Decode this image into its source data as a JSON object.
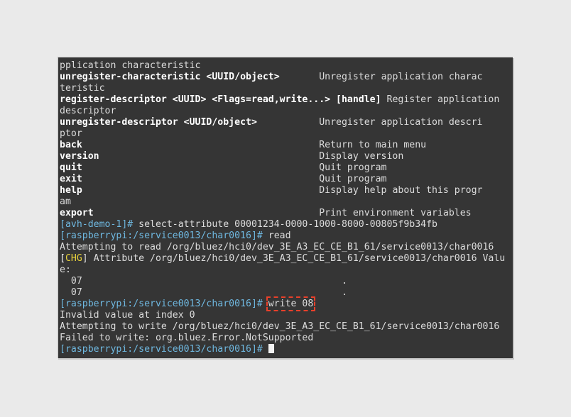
{
  "app": {
    "title": "bluetoothctl terminal session",
    "background_color": "#eaeaea",
    "terminal_bg": "#353535",
    "fg_color": "#dcdcdc",
    "prompt_color": "#6fb8e0",
    "event_tag_color": "#e7d13c",
    "highlight_color": "#e8402a"
  },
  "terminal": {
    "lines": [
      {
        "id": "l01",
        "segments": [
          {
            "text": "pplication characteristic",
            "style": "plain"
          }
        ]
      },
      {
        "id": "l02",
        "segments": [
          {
            "text": "unregister-characteristic <UUID/object>",
            "style": "bold"
          },
          {
            "text": "       Unregister application charac",
            "style": "plain"
          }
        ]
      },
      {
        "id": "l03",
        "segments": [
          {
            "text": "teristic",
            "style": "plain"
          }
        ]
      },
      {
        "id": "l04",
        "segments": [
          {
            "text": "register-descriptor <UUID> <Flags=read,write...> [handle]",
            "style": "bold"
          },
          {
            "text": " Register application",
            "style": "plain"
          }
        ]
      },
      {
        "id": "l05",
        "segments": [
          {
            "text": "descriptor",
            "style": "plain"
          }
        ]
      },
      {
        "id": "l06",
        "segments": [
          {
            "text": "unregister-descriptor <UUID/object>",
            "style": "bold"
          },
          {
            "text": "           Unregister application descri",
            "style": "plain"
          }
        ]
      },
      {
        "id": "l07",
        "segments": [
          {
            "text": "ptor",
            "style": "plain"
          }
        ]
      },
      {
        "id": "l08",
        "segments": [
          {
            "text": "back",
            "style": "bold"
          },
          {
            "text": "                                          Return to main menu",
            "style": "plain"
          }
        ]
      },
      {
        "id": "l09",
        "segments": [
          {
            "text": "version",
            "style": "bold"
          },
          {
            "text": "                                       Display version",
            "style": "plain"
          }
        ]
      },
      {
        "id": "l10",
        "segments": [
          {
            "text": "quit",
            "style": "bold"
          },
          {
            "text": "                                          Quit program",
            "style": "plain"
          }
        ]
      },
      {
        "id": "l11",
        "segments": [
          {
            "text": "exit",
            "style": "bold"
          },
          {
            "text": "                                          Quit program",
            "style": "plain"
          }
        ]
      },
      {
        "id": "l12",
        "segments": [
          {
            "text": "help",
            "style": "bold"
          },
          {
            "text": "                                          Display help about this progr",
            "style": "plain"
          }
        ]
      },
      {
        "id": "l13",
        "segments": [
          {
            "text": "am",
            "style": "plain"
          }
        ]
      },
      {
        "id": "l14",
        "segments": [
          {
            "text": "export",
            "style": "bold"
          },
          {
            "text": "                                        Print environment variables",
            "style": "plain"
          }
        ]
      },
      {
        "id": "l15",
        "segments": [
          {
            "text": "[avh-demo-1]# ",
            "style": "cyan"
          },
          {
            "text": "select-attribute 00001234-0000-1000-8000-00805f9b34fb",
            "style": "plain"
          }
        ]
      },
      {
        "id": "l16",
        "segments": [
          {
            "text": "[raspberrypi:/service0013/char0016]# ",
            "style": "cyan"
          },
          {
            "text": "read",
            "style": "plain"
          }
        ]
      },
      {
        "id": "l17",
        "segments": [
          {
            "text": "Attempting to read /org/bluez/hci0/dev_3E_A3_EC_CE_B1_61/service0013/char0016",
            "style": "plain"
          }
        ]
      },
      {
        "id": "l18",
        "segments": [
          {
            "text": "[",
            "style": "white"
          },
          {
            "text": "CHG",
            "style": "yellow"
          },
          {
            "text": "] Attribute /org/bluez/hci0/dev_3E_A3_EC_CE_B1_61/service0013/char0016 Valu",
            "style": "plain"
          }
        ]
      },
      {
        "id": "l19",
        "segments": [
          {
            "text": "e:",
            "style": "plain"
          }
        ]
      },
      {
        "id": "l20",
        "segments": [
          {
            "text": "  07                                              .",
            "style": "plain"
          }
        ]
      },
      {
        "id": "l21",
        "segments": [
          {
            "text": "  07                                              .",
            "style": "plain"
          }
        ]
      },
      {
        "id": "l22",
        "highlight": true,
        "segments": [
          {
            "text": "[raspberrypi:/service0013/char0016]# ",
            "style": "cyan"
          },
          {
            "text": "write 08",
            "style": "plain",
            "boxed": true
          }
        ]
      },
      {
        "id": "l23",
        "segments": [
          {
            "text": "Invalid value at index 0",
            "style": "plain"
          }
        ]
      },
      {
        "id": "l24",
        "segments": [
          {
            "text": "Attempting to write /org/bluez/hci0/dev_3E_A3_EC_CE_B1_61/service0013/char0016",
            "style": "plain"
          }
        ]
      },
      {
        "id": "l25",
        "segments": [
          {
            "text": "Failed to write: org.bluez.Error.NotSupported",
            "style": "plain"
          }
        ]
      },
      {
        "id": "l26",
        "cursor": true,
        "segments": [
          {
            "text": "[raspberrypi:/service0013/char0016]# ",
            "style": "cyan"
          }
        ]
      }
    ],
    "highlighted_command": "write 08",
    "cursor": "block"
  }
}
